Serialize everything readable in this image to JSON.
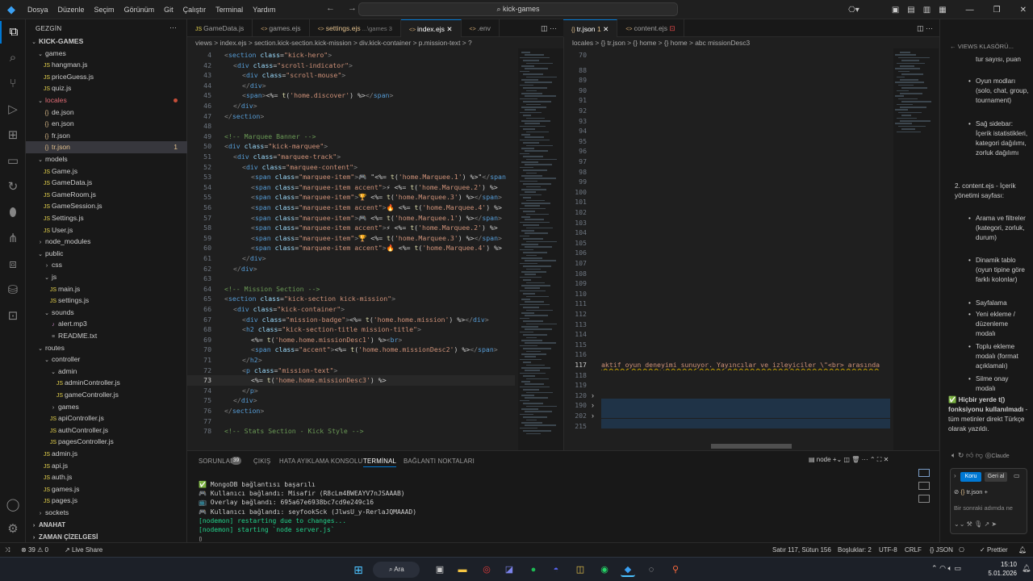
{
  "titlebar": {
    "menu": [
      "Dosya",
      "Düzenle",
      "Seçim",
      "Görünüm",
      "Git",
      "Çalıştır",
      "Terminal",
      "Yardım"
    ],
    "search": "kick-games",
    "icons": [
      "layout-sidebar-left-icon",
      "layout-panel-icon",
      "layout-sidebar-right-icon",
      "customize-layout-icon",
      "minimize-icon",
      "restore-icon",
      "close-icon"
    ]
  },
  "sidebar": {
    "title": "GEZGİN",
    "items": [
      {
        "label": "KICK-GAMES",
        "type": "root",
        "indent": 0
      },
      {
        "label": "games",
        "type": "folder-open",
        "indent": 1
      },
      {
        "label": "hangman.js",
        "type": "js",
        "indent": 2
      },
      {
        "label": "priceGuess.js",
        "type": "js",
        "indent": 2
      },
      {
        "label": "quiz.js",
        "type": "js",
        "indent": 2
      },
      {
        "label": "locales",
        "type": "folder-open",
        "indent": 1,
        "color": "#e06c75",
        "dot": true
      },
      {
        "label": "de.json",
        "type": "json",
        "indent": 2
      },
      {
        "label": "en.json",
        "type": "json",
        "indent": 2
      },
      {
        "label": "fr.json",
        "type": "json",
        "indent": 2
      },
      {
        "label": "tr.json",
        "type": "json",
        "indent": 2,
        "selected": true,
        "badge": "1",
        "color": "#e2c08d"
      },
      {
        "label": "models",
        "type": "folder-open",
        "indent": 1
      },
      {
        "label": "Game.js",
        "type": "js",
        "indent": 2
      },
      {
        "label": "GameData.js",
        "type": "js",
        "indent": 2
      },
      {
        "label": "GameRoom.js",
        "type": "js",
        "indent": 2
      },
      {
        "label": "GameSession.js",
        "type": "js",
        "indent": 2
      },
      {
        "label": "Settings.js",
        "type": "js",
        "indent": 2
      },
      {
        "label": "User.js",
        "type": "js",
        "indent": 2
      },
      {
        "label": "node_modules",
        "type": "folder",
        "indent": 1
      },
      {
        "label": "public",
        "type": "folder-open",
        "indent": 1
      },
      {
        "label": "css",
        "type": "folder",
        "indent": 2
      },
      {
        "label": "js",
        "type": "folder-open",
        "indent": 2
      },
      {
        "label": "main.js",
        "type": "js",
        "indent": 3
      },
      {
        "label": "settings.js",
        "type": "js",
        "indent": 3
      },
      {
        "label": "sounds",
        "type": "folder-open",
        "indent": 2
      },
      {
        "label": "alert.mp3",
        "type": "audio",
        "indent": 3
      },
      {
        "label": "README.txt",
        "type": "txt",
        "indent": 3
      },
      {
        "label": "routes",
        "type": "folder-open",
        "indent": 1
      },
      {
        "label": "controller",
        "type": "folder-open",
        "indent": 2
      },
      {
        "label": "admin",
        "type": "folder-open",
        "indent": 3
      },
      {
        "label": "adminController.js",
        "type": "js",
        "indent": 4
      },
      {
        "label": "gameController.js",
        "type": "js",
        "indent": 4
      },
      {
        "label": "games",
        "type": "folder",
        "indent": 3
      },
      {
        "label": "apiController.js",
        "type": "js",
        "indent": 3
      },
      {
        "label": "authController.js",
        "type": "js",
        "indent": 3
      },
      {
        "label": "pagesController.js",
        "type": "js",
        "indent": 3
      },
      {
        "label": "admin.js",
        "type": "js",
        "indent": 2
      },
      {
        "label": "api.js",
        "type": "js",
        "indent": 2
      },
      {
        "label": "auth.js",
        "type": "js",
        "indent": 2
      },
      {
        "label": "games.js",
        "type": "js",
        "indent": 2
      },
      {
        "label": "pages.js",
        "type": "js",
        "indent": 2
      },
      {
        "label": "sockets",
        "type": "folder",
        "indent": 1
      }
    ],
    "outline": "ANAHAT",
    "timeline": "ZAMAN ÇİZELGESİ"
  },
  "editor1": {
    "tabs": [
      {
        "label": "GameData.js",
        "active": false
      },
      {
        "label": "games.ejs",
        "active": false
      },
      {
        "label": "settings.ejs",
        "sub": "...\\games 3",
        "active": false,
        "modified": true
      },
      {
        "label": "index.ejs",
        "active": true
      },
      {
        "label": ".env",
        "active": false
      }
    ],
    "breadcrumb": "views > index.ejs > section.kick-section.kick-mission > div.kick-container > p.mission-text > ?",
    "lines": [
      {
        "n": "4",
        "html": "<span class='p'>&lt;</span><span class='t'>section</span> <span class='a'>class</span>=<span class='s'>\"kick-hero\"</span><span class='p'>&gt;</span>",
        "i": 0
      },
      {
        "n": "42",
        "html": "<span class='p'>&lt;</span><span class='t'>div</span> <span class='a'>class</span>=<span class='s'>\"scroll-indicator\"</span><span class='p'>&gt;</span>",
        "i": 1
      },
      {
        "n": "43",
        "html": "<span class='p'>&lt;</span><span class='t'>div</span> <span class='a'>class</span>=<span class='s'>\"scroll-mouse\"</span><span class='p'>&gt;</span>",
        "i": 2
      },
      {
        "n": "44",
        "html": "<span class='p'>&lt;/</span><span class='t'>div</span><span class='p'>&gt;</span>",
        "i": 2
      },
      {
        "n": "45",
        "html": "<span class='p'>&lt;</span><span class='t'>span</span><span class='p'>&gt;</span>&lt;%= <span class='f'>t</span>(<span class='s'>'home.discover'</span>) %&gt;<span class='p'>&lt;/</span><span class='t'>span</span><span class='p'>&gt;</span>",
        "i": 2
      },
      {
        "n": "46",
        "html": "<span class='p'>&lt;/</span><span class='t'>div</span><span class='p'>&gt;</span>",
        "i": 1
      },
      {
        "n": "47",
        "html": "<span class='p'>&lt;/</span><span class='t'>section</span><span class='p'>&gt;</span>",
        "i": 0
      },
      {
        "n": "48",
        "html": "",
        "i": 0
      },
      {
        "n": "49",
        "html": "<span class='c'>&lt;!-- Marquee Banner --&gt;</span>",
        "i": 0
      },
      {
        "n": "50",
        "html": "<span class='p'>&lt;</span><span class='t'>div</span> <span class='a'>class</span>=<span class='s'>\"kick-marquee\"</span><span class='p'>&gt;</span>",
        "i": 0
      },
      {
        "n": "51",
        "html": "<span class='p'>&lt;</span><span class='t'>div</span> <span class='a'>class</span>=<span class='s'>\"marquee-track\"</span><span class='p'>&gt;</span>",
        "i": 1
      },
      {
        "n": "52",
        "html": "<span class='p'>&lt;</span><span class='t'>div</span> <span class='a'>class</span>=<span class='s'>\"marquee-content\"</span><span class='p'>&gt;</span>",
        "i": 2
      },
      {
        "n": "53",
        "html": "<span class='p'>&lt;</span><span class='t'>span</span> <span class='a'>class</span>=<span class='s'>\"marquee-item\"</span><span class='p'>&gt;</span>🎮 \"&lt;%= <span class='f'>t</span>(<span class='s'>'home.Marquee.1'</span>) %&gt;\"<span class='p'>&lt;/</span><span class='t'>span</span>",
        "i": 3
      },
      {
        "n": "54",
        "html": "<span class='p'>&lt;</span><span class='t'>span</span> <span class='a'>class</span>=<span class='s'>\"marquee-item accent\"</span><span class='p'>&gt;</span>⚡ &lt;%= <span class='f'>t</span>(<span class='s'>'home.Marquee.2'</span>) %&gt;",
        "i": 3
      },
      {
        "n": "55",
        "html": "<span class='p'>&lt;</span><span class='t'>span</span> <span class='a'>class</span>=<span class='s'>\"marquee-item\"</span><span class='p'>&gt;</span>🏆 &lt;%= <span class='f'>t</span>(<span class='s'>'home.Marquee.3'</span>) %&gt;<span class='p'>&lt;/</span><span class='t'>span</span><span class='p'>&gt;</span>",
        "i": 3
      },
      {
        "n": "56",
        "html": "<span class='p'>&lt;</span><span class='t'>span</span> <span class='a'>class</span>=<span class='s'>\"marquee-item accent\"</span><span class='p'>&gt;</span>🔥 &lt;%= <span class='f'>t</span>(<span class='s'>'home.Marquee.4'</span>) %&gt;",
        "i": 3
      },
      {
        "n": "57",
        "html": "<span class='p'>&lt;</span><span class='t'>span</span> <span class='a'>class</span>=<span class='s'>\"marquee-item\"</span><span class='p'>&gt;</span>🎮 &lt;%= <span class='f'>t</span>(<span class='s'>'home.Marquee.1'</span>) %&gt;<span class='p'>&lt;/</span><span class='t'>span</span><span class='p'>&gt;</span>",
        "i": 3
      },
      {
        "n": "58",
        "html": "<span class='p'>&lt;</span><span class='t'>span</span> <span class='a'>class</span>=<span class='s'>\"marquee-item accent\"</span><span class='p'>&gt;</span>⚡ &lt;%= <span class='f'>t</span>(<span class='s'>'home.Marquee.2'</span>) %&gt;",
        "i": 3
      },
      {
        "n": "59",
        "html": "<span class='p'>&lt;</span><span class='t'>span</span> <span class='a'>class</span>=<span class='s'>\"marquee-item\"</span><span class='p'>&gt;</span>🏆 &lt;%= <span class='f'>t</span>(<span class='s'>'home.Marquee.3'</span>) %&gt;<span class='p'>&lt;/</span><span class='t'>span</span><span class='p'>&gt;</span>",
        "i": 3
      },
      {
        "n": "60",
        "html": "<span class='p'>&lt;</span><span class='t'>span</span> <span class='a'>class</span>=<span class='s'>\"marquee-item accent\"</span><span class='p'>&gt;</span>🔥 &lt;%= <span class='f'>t</span>(<span class='s'>'home.Marquee.4'</span>) %&gt;",
        "i": 3
      },
      {
        "n": "61",
        "html": "<span class='p'>&lt;/</span><span class='t'>div</span><span class='p'>&gt;</span>",
        "i": 2
      },
      {
        "n": "62",
        "html": "<span class='p'>&lt;/</span><span class='t'>div</span><span class='p'>&gt;</span>",
        "i": 1
      },
      {
        "n": "63",
        "html": "",
        "i": 0
      },
      {
        "n": "64",
        "html": "<span class='c'>&lt;!-- Mission Section --&gt;</span>",
        "i": 0
      },
      {
        "n": "65",
        "html": "<span class='p'>&lt;</span><span class='t'>section</span> <span class='a'>class</span>=<span class='s'>\"kick-section kick-mission\"</span><span class='p'>&gt;</span>",
        "i": 0
      },
      {
        "n": "66",
        "html": "<span class='p'>&lt;</span><span class='t'>div</span> <span class='a'>class</span>=<span class='s'>\"kick-container\"</span><span class='p'>&gt;</span>",
        "i": 1
      },
      {
        "n": "67",
        "html": "<span class='p'>&lt;</span><span class='t'>div</span> <span class='a'>class</span>=<span class='s'>\"mission-badge\"</span><span class='p'>&gt;</span>&lt;%= <span class='f'>t</span>(<span class='s'>'home.home.mission'</span>) %&gt;<span class='p'>&lt;/</span><span class='t'>div</span><span class='p'>&gt;</span>",
        "i": 2
      },
      {
        "n": "68",
        "html": "<span class='p'>&lt;</span><span class='t'>h2</span> <span class='a'>class</span>=<span class='s'>\"kick-section-title mission-title\"</span><span class='p'>&gt;</span>",
        "i": 2
      },
      {
        "n": "69",
        "html": "&lt;%= <span class='f'>t</span>(<span class='s'>'home.home.missionDesc1'</span>) %&gt;<span class='p'>&lt;</span><span class='t'>br</span><span class='p'>&gt;</span>",
        "i": 3
      },
      {
        "n": "70",
        "html": "<span class='p'>&lt;</span><span class='t'>span</span> <span class='a'>class</span>=<span class='s'>\"accent\"</span><span class='p'>&gt;</span>&lt;%= <span class='f'>t</span>(<span class='s'>'home.home.missionDesc2'</span>) %&gt;<span class='p'>&lt;/</span><span class='t'>span</span><span class='p'>&gt;</span>",
        "i": 3
      },
      {
        "n": "71",
        "html": "<span class='p'>&lt;/</span><span class='t'>h2</span><span class='p'>&gt;</span>",
        "i": 2
      },
      {
        "n": "72",
        "html": "<span class='p'>&lt;</span><span class='t'>p</span> <span class='a'>class</span>=<span class='s'>\"mission-text\"</span><span class='p'>&gt;</span>",
        "i": 2
      },
      {
        "n": "73",
        "html": "&lt;%= <span class='f'>t</span>(<span class='s'>'home.home.missionDesc3'</span>) %&gt;",
        "i": 3,
        "current": true
      },
      {
        "n": "74",
        "html": "<span class='p'>&lt;/</span><span class='t'>p</span><span class='p'>&gt;</span>",
        "i": 2
      },
      {
        "n": "75",
        "html": "<span class='p'>&lt;/</span><span class='t'>div</span><span class='p'>&gt;</span>",
        "i": 1
      },
      {
        "n": "76",
        "html": "<span class='p'>&lt;/</span><span class='t'>section</span><span class='p'>&gt;</span>",
        "i": 0
      },
      {
        "n": "77",
        "html": "",
        "i": 0
      },
      {
        "n": "78",
        "html": "<span class='c'>&lt;!-- Stats Section - Kick Style --&gt;</span>",
        "i": 0
      }
    ]
  },
  "editor2": {
    "tabs": [
      {
        "label": "tr.json",
        "badge": "1",
        "active": true
      },
      {
        "label": "content.ejs",
        "active": false,
        "error": true
      }
    ],
    "breadcrumb": "locales > {} tr.json > {} home > {} home > abc missionDesc3",
    "lines": [
      "70",
      "88",
      "89",
      "90",
      "91",
      "92",
      "93",
      "94",
      "95",
      "96",
      "97",
      "98",
      "99",
      "100",
      "101",
      "102",
      "103",
      "104",
      "105",
      "106",
      "107",
      "108",
      "109",
      "110",
      "111",
      "112",
      "113",
      "114",
      "115",
      "116",
      "117",
      "118",
      "119",
      "120",
      "190",
      "202",
      "215"
    ],
    "current_line": "117",
    "current_text": "aktif oyun deneyimi sunuyor. Yayıncılar ve izleyiciler \\\"<br> arasında",
    "folded": [
      "120",
      "190",
      "202"
    ]
  },
  "rightpanel": {
    "header": "VIEWS KLASÖRÜ...",
    "items": [
      {
        "text": "tur sayısı, puan",
        "level": 2,
        "bullet": false
      },
      {
        "text": "Oyun modları (solo, chat, group, tournament)",
        "level": 2,
        "bullet": true
      },
      {
        "text": "Sağ sidebar: İçerik istatistikleri, kategori dağılımı, zorluk dağılımı",
        "level": 2,
        "bullet": true
      },
      {
        "text": "2. content.ejs - İçerik yönetimi sayfası:",
        "level": 1,
        "bullet": false
      },
      {
        "text": "Arama ve filtreler (kategori, zorluk, durum)",
        "level": 2,
        "bullet": true
      },
      {
        "text": "Dinamik tablo (oyun tipine göre farklı kolonlar)",
        "level": 2,
        "bullet": true
      },
      {
        "text": "Sayfalama",
        "level": 2,
        "bullet": true
      },
      {
        "text": "Yeni ekleme / düzenleme modalı",
        "level": 2,
        "bullet": true
      },
      {
        "text": "Toplu ekleme modalı (format açıklamalı)",
        "level": 2,
        "bullet": true
      },
      {
        "text": "Silme onay modalı",
        "level": 2,
        "bullet": true
      }
    ],
    "note_bold": "Hiçbir yerde t() fonksiyonu kullanılmadı",
    "note_rest": " - tüm metinler direkt Türkçe olarak yazıldı.",
    "claude": "Claude",
    "keep": "Koru",
    "undo": "Geri al",
    "file": "tr.json",
    "placeholder": "Bir sonraki adımda ne"
  },
  "panel": {
    "tabs": [
      "SORUNLAR",
      "ÇIKIŞ",
      "HATA AYIKLAMA KONSOLU",
      "TERMİNAL",
      "BAĞLANTI NOKTALARI"
    ],
    "problem_count": "39",
    "active": "TERMİNAL",
    "shell": "node",
    "terminal": [
      "✅ MongoDB bağlantısı başarılı",
      "🎮 Kullanıcı bağlandı: Misafir (R8cLm4BWEAYV7nJSAAAB)",
      "📺 Overlay bağlandı: 695a67e6938bc7cd9e249c16",
      "🎮 Kullanıcı bağlandı: seyfookSck (JlwsU_y-RerlaJQMAAAD)",
      "[nodemon] restarting due to changes...",
      "[nodemon] starting `node server.js`"
    ]
  },
  "status": {
    "errors": "39",
    "warnings": "0",
    "liveshare": "Live Share",
    "position": "Satır 117, Sütun 156",
    "spaces": "Boşluklar: 2",
    "encoding": "UTF-8",
    "eol": "CRLF",
    "language": "JSON",
    "prettier": "Prettier"
  },
  "taskbar": {
    "search": "Ara",
    "time": "15:10",
    "date": "5.01.2026"
  }
}
